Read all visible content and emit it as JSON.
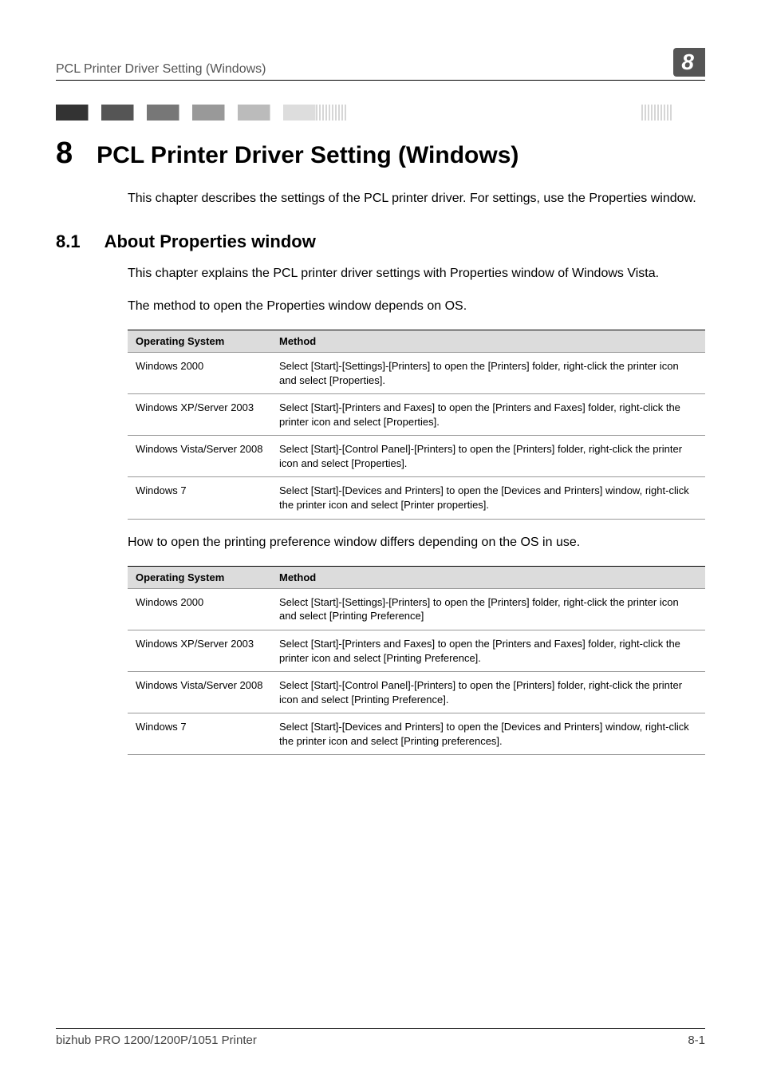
{
  "header": {
    "left": "PCL Printer Driver Setting (Windows)",
    "badge": "8"
  },
  "chapter": {
    "number": "8",
    "title": "PCL Printer Driver Setting (Windows)"
  },
  "intro": "This chapter describes the settings of the PCL printer driver. For settings, use the Properties window.",
  "section": {
    "number": "8.1",
    "title": "About Properties window"
  },
  "section_text1": "This chapter explains the PCL printer driver settings with Properties window of Windows Vista.",
  "section_text2": "The method to open the Properties window depends on OS.",
  "table1": {
    "headers": [
      "Operating System",
      "Method"
    ],
    "rows": [
      [
        "Windows 2000",
        "Select [Start]-[Settings]-[Printers] to open the [Printers] folder, right-click the printer icon and select [Properties]."
      ],
      [
        "Windows XP/Server 2003",
        "Select [Start]-[Printers and Faxes] to open the [Printers and Faxes] folder, right-click the printer icon and select [Properties]."
      ],
      [
        "Windows Vista/Server 2008",
        "Select [Start]-[Control Panel]-[Printers] to open the [Printers] folder, right-click the printer icon and select [Properties]."
      ],
      [
        "Windows 7",
        "Select [Start]-[Devices and Printers] to open the [Devices and Printers] window, right-click the printer icon and select [Printer properties]."
      ]
    ]
  },
  "between_tables_text": "How to open the printing preference window differs depending on the OS in use.",
  "table2": {
    "headers": [
      "Operating System",
      "Method"
    ],
    "rows": [
      [
        "Windows 2000",
        "Select [Start]-[Settings]-[Printers] to open the [Printers] folder, right-click the printer icon and select [Printing Preference]"
      ],
      [
        "Windows XP/Server 2003",
        "Select [Start]-[Printers and Faxes] to open the [Printers and Faxes] folder, right-click the printer icon and select [Printing Preference]."
      ],
      [
        "Windows Vista/Server 2008",
        "Select [Start]-[Control Panel]-[Printers] to open the [Printers] folder, right-click the printer icon and select [Printing Preference]."
      ],
      [
        "Windows 7",
        "Select [Start]-[Devices and Printers] to open the [Devices and Printers] window, right-click the printer icon and select [Printing preferences]."
      ]
    ]
  },
  "footer": {
    "left": "bizhub PRO 1200/1200P/1051 Printer",
    "right": "8-1"
  }
}
